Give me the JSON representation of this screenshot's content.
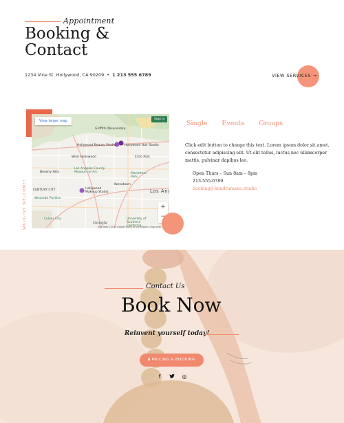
{
  "header": {
    "script_label": "Appointment",
    "title_line1": "Booking &",
    "title_line2": "Contact",
    "address": "1234 Vine St. Hollywood, CA 90209",
    "separator": "•",
    "phone": "1 213 555 6789",
    "view_services_label": "VIEW SERVICES",
    "view_services_arrow": "→"
  },
  "map": {
    "view_larger_label": "View larger map",
    "sign_in_label": "Sign in",
    "labels": {
      "griffith": "Griffith Observatory",
      "beauty": "Hollywood Beauty Studio",
      "hair": "Hollywood Hair Studio",
      "west_hollywood": "West Hollywood",
      "beverly_hills": "Beverly Hills",
      "lacma": "Los Angeles County Museum of Art",
      "macarthur": "MacArthur Park",
      "makeup": "Hollywood Makeup Studio",
      "los_angeles": "Los Angeles",
      "westside": "Westside Pavilion",
      "culver": "Culver City",
      "usc": "University of Southern California",
      "koreatown": "Koreatown",
      "century_city": "CENTURY CITY",
      "echo_park": "Echo Park"
    },
    "zoom_in": "+",
    "zoom_out": "−",
    "google": "Google",
    "footer": "Map data ©2019 Google   Terms of Use   Report a map error",
    "vertical_label": "WALK-INS WELCOME!"
  },
  "info": {
    "tabs": [
      "Single",
      "Events",
      "Groups"
    ],
    "description": "Click edit button to change this text. Lorem ipsum dolor sit amet, consectetur adipiscing elit. Ut elit tellus, luctus nec ullamcorper mattis, pulvinar dapibus leo.",
    "hours": "Open Thurs – Sun 8am – 8pm",
    "phone": "213-555-6789",
    "email": "booking@kendramane.studio"
  },
  "hero": {
    "script_label": "Contact Us",
    "heading": "Book Now",
    "tagline": "Reinvent yourself today!",
    "button_label": "⧫ PRICING & BOOKING",
    "social": [
      "f",
      "🐦",
      "◎"
    ]
  },
  "colors": {
    "accent": "#f08c6e",
    "accent_dark": "#e8684a",
    "hero_bg": "#f6e6dc"
  }
}
